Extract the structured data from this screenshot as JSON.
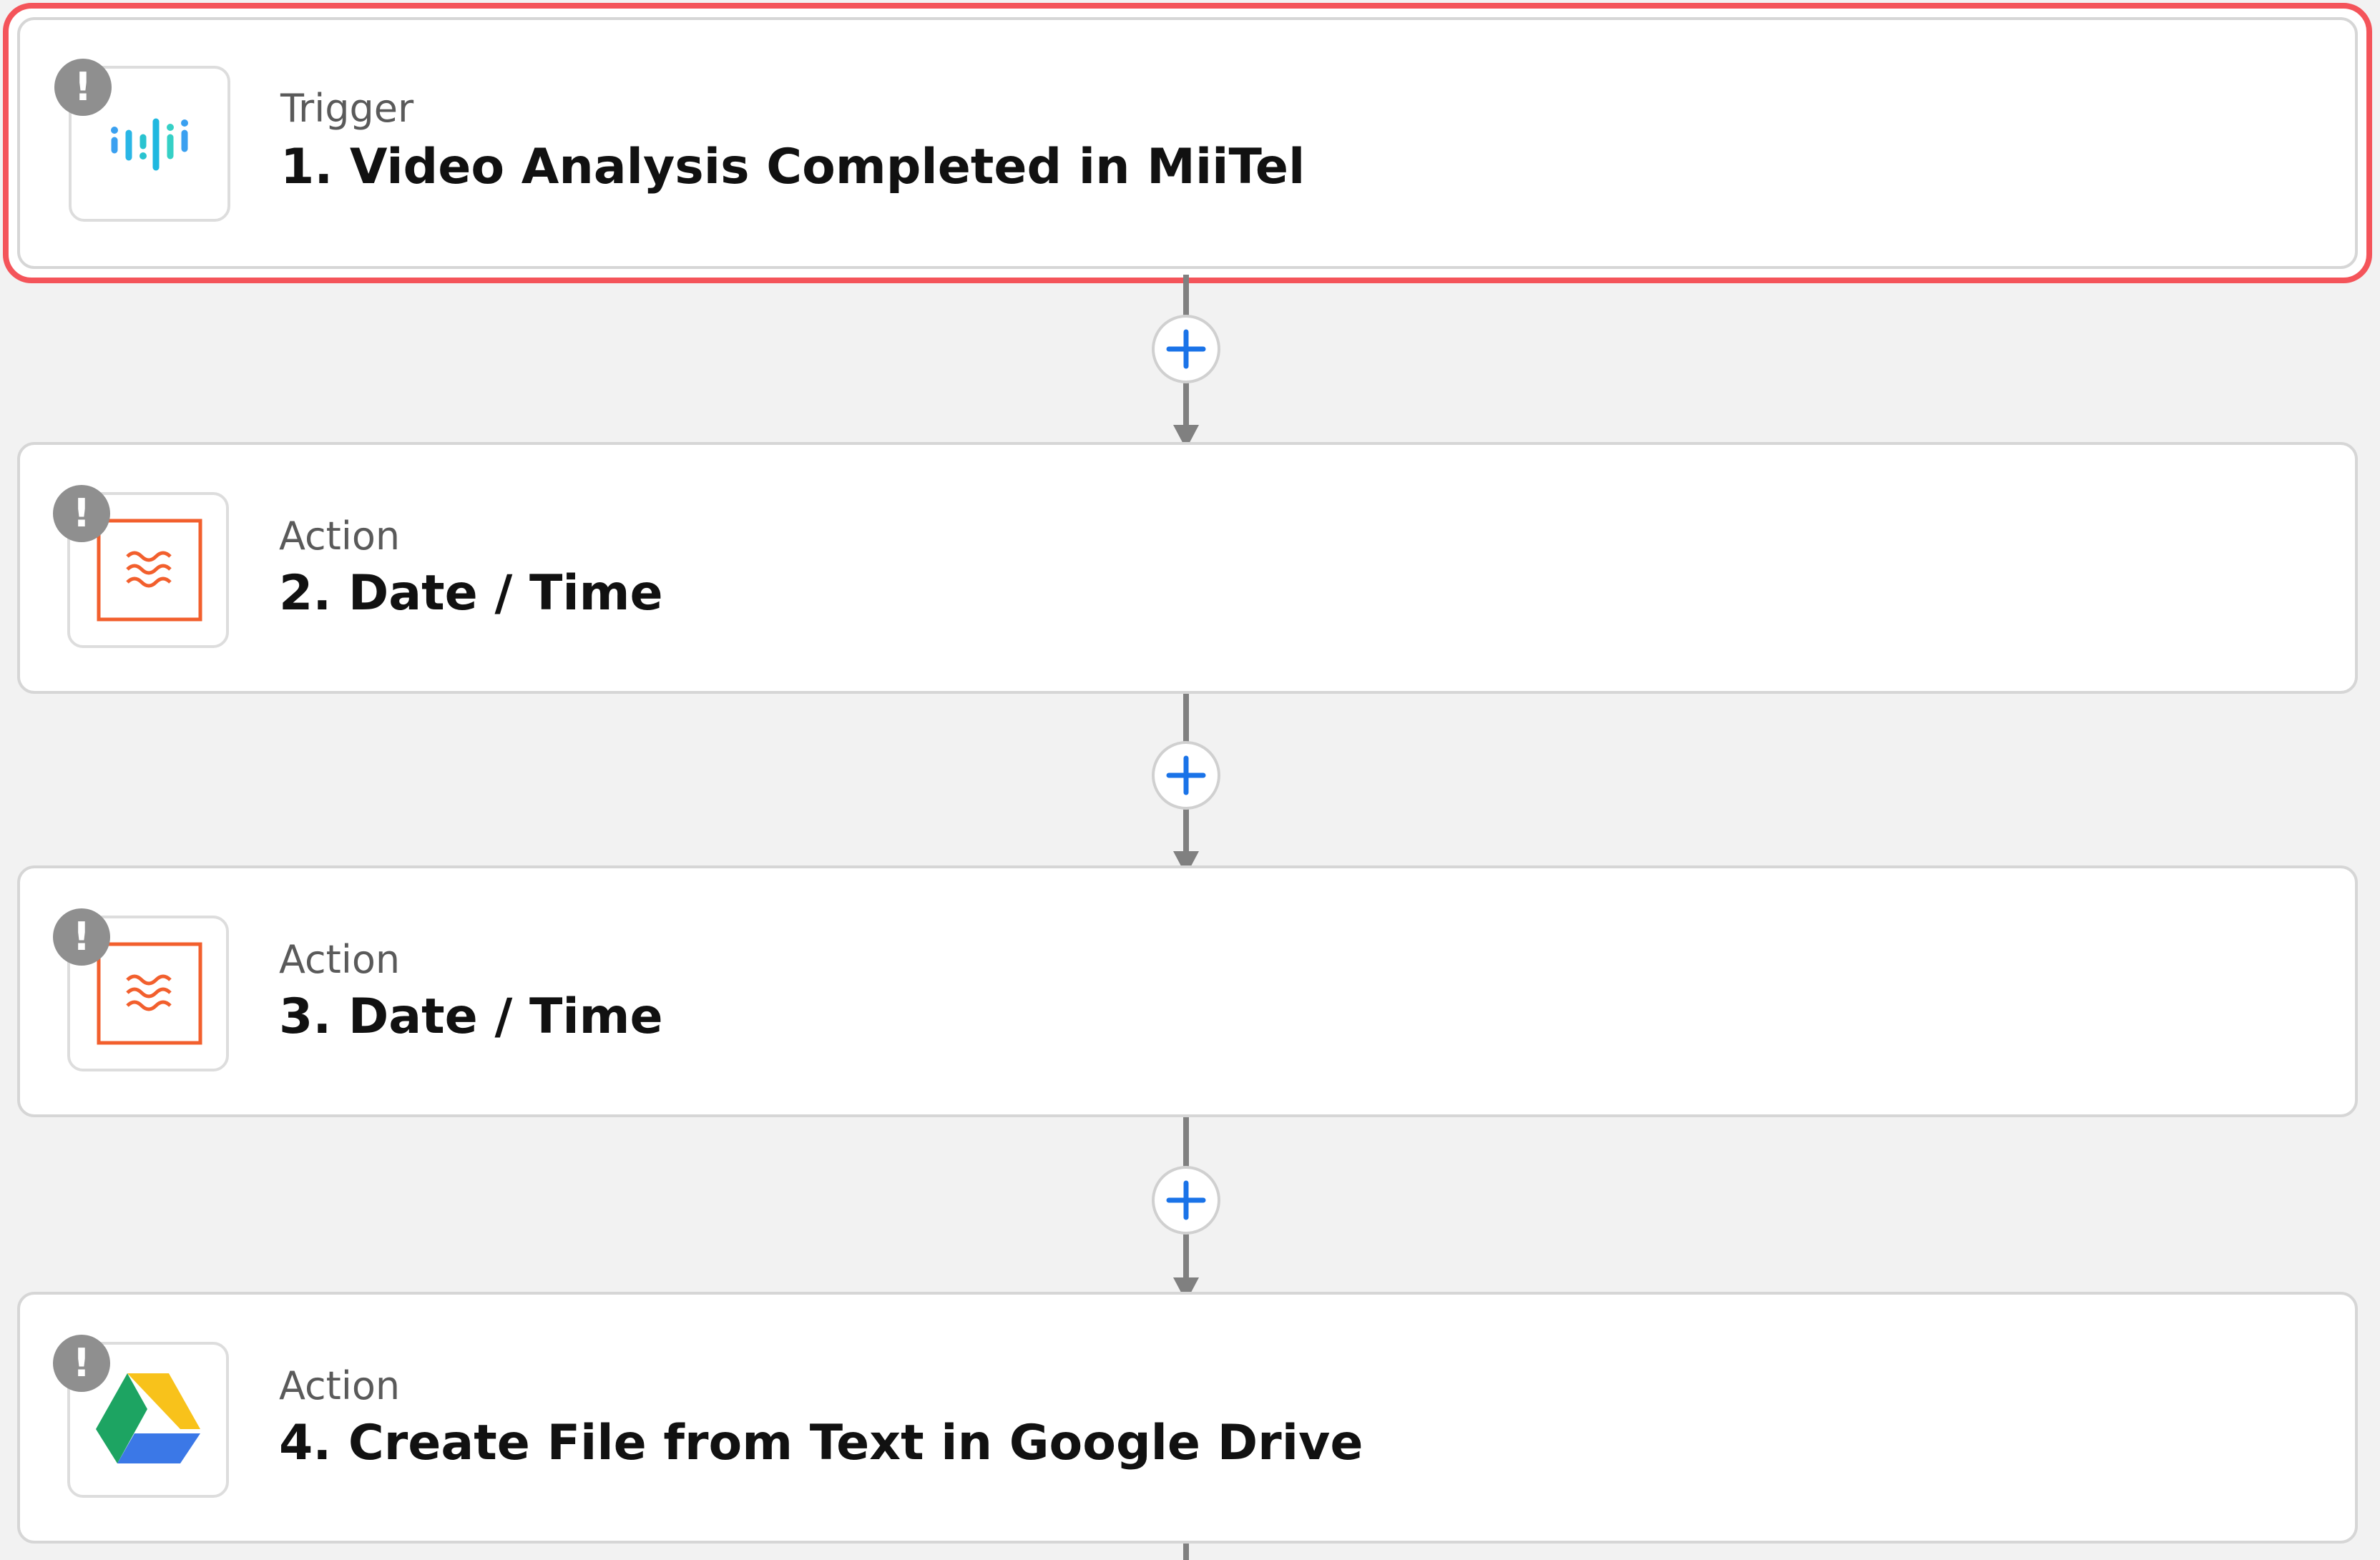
{
  "steps": [
    {
      "kind": "Trigger",
      "title": "1. Video Analysis Completed in MiiTel",
      "app_icon": "miitel-icon",
      "selected": true,
      "status_icon": "warning-icon"
    },
    {
      "kind": "Action",
      "title": "2. Date / Time",
      "app_icon": "formatter-icon",
      "selected": false,
      "status_icon": "warning-icon"
    },
    {
      "kind": "Action",
      "title": "3. Date / Time",
      "app_icon": "formatter-icon",
      "selected": false,
      "status_icon": "warning-icon"
    },
    {
      "kind": "Action",
      "title": "4. Create File from Text in Google Drive",
      "app_icon": "google-drive-icon",
      "selected": false,
      "status_icon": "warning-icon"
    }
  ],
  "warning_glyph": "!",
  "colors": {
    "selected_border": "#f4545a",
    "add_button_plus": "#1a73e8",
    "formatter_orange": "#f25f2d",
    "connector": "#808080"
  }
}
